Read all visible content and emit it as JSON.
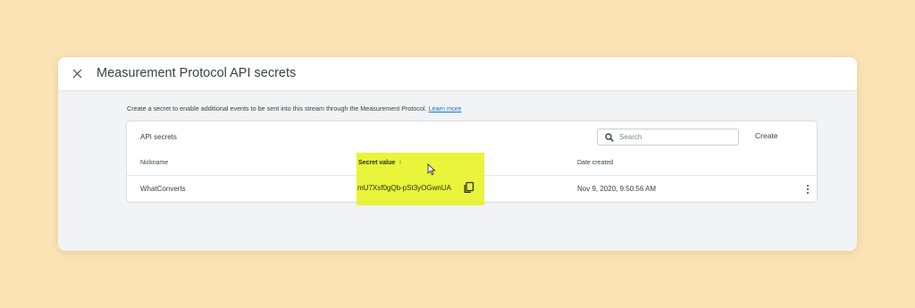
{
  "dialog": {
    "title": "Measurement Protocol API secrets",
    "intro_text": "Create a secret to enable additional events to be sent into this stream through the Measurement Protocol.",
    "learn_more": "Learn more"
  },
  "card": {
    "title": "API secrets",
    "search_placeholder": "Search",
    "create_label": "Create",
    "columns": {
      "nickname": "Nickname",
      "secret_value": "Secret value",
      "sort_arrow": "↑",
      "date_created": "Date created"
    },
    "rows": [
      {
        "nickname": "WhatConverts",
        "secret_value": "mU7Xsf0gQb-pSt3yOGwnUA",
        "date_created": "Nov 9, 2020, 9:50:56 AM"
      }
    ]
  },
  "colors": {
    "background": "#fbe3b4",
    "highlight": "#e4f210",
    "link": "#1a73e8"
  },
  "icons": [
    "close-icon",
    "search-icon",
    "copy-icon",
    "more-vert-icon",
    "mouse-cursor-icon"
  ]
}
